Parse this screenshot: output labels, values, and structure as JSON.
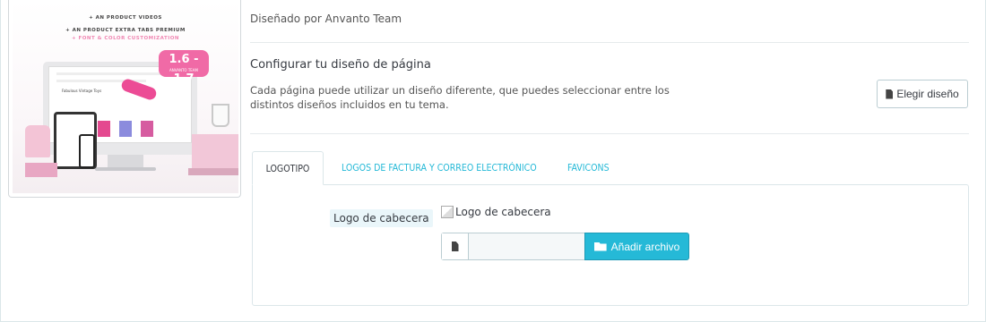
{
  "theme_preview": {
    "promo_line_1": "+ AN PRODUCT VIDEOS",
    "promo_line_2": "+ AN PRODUCT EXTRA TABS PREMIUM",
    "promo_line_3": "+ FONT & COLOR CUSTOMIZATION",
    "version_badge": "1.6 - 1.7",
    "version_sub": "ANVANTO TEAM",
    "screen_heading": "Fabulous Vintage Toys"
  },
  "theme_info": {
    "designed_by": "Diseñado por Anvanto Team"
  },
  "layout_section": {
    "title": "Configurar tu diseño de página",
    "description": "Cada página puede utilizar un diseño diferente, que puedes seleccionar entre los distintos diseños incluidos en tu tema.",
    "choose_button_label": "Elegir diseño",
    "choose_button_icon": "file-icon"
  },
  "tabs": [
    {
      "label": "LOGOTIPO",
      "active": true
    },
    {
      "label": "LOGOS DE FACTURA Y CORREO ELECTRÓNICO",
      "active": false
    },
    {
      "label": "FAVICONS",
      "active": false
    }
  ],
  "logo_tab": {
    "field_label": "Logo de cabecera",
    "image_alt": "Logo de cabecera",
    "file_input_value": "",
    "file_icon": "file-icon",
    "add_button_label": "Añadir archivo",
    "add_button_icon": "folder-open-icon"
  },
  "colors": {
    "accent": "#25b9d7",
    "label_bg": "#eaf6fa",
    "badge_pink": "#f06aa6"
  }
}
